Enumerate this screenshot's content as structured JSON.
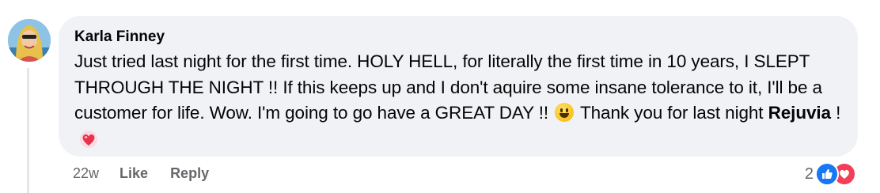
{
  "comment": {
    "author": "Karla Finney",
    "text_part1": "Just tried last night for the first time. HOLY HELL, for literally the first time in 10 years, I SLEPT THROUGH THE NIGHT !! If this keeps up and I don't aquire some insane tolerance to it, I'll be a customer for life. Wow. I'm going to go have a GREAT DAY !!",
    "text_part2": " Thank you for last night ",
    "mention": "Rejuvia",
    "text_part3": " !",
    "emojis": [
      "grinning-face-emoji",
      "heart-emoji"
    ]
  },
  "actions": {
    "timestamp": "22w",
    "like_label": "Like",
    "reply_label": "Reply"
  },
  "reactions": {
    "count": "2",
    "types": [
      "like",
      "love"
    ],
    "colors": {
      "like": "#1877f2",
      "love": "#f33e58"
    }
  }
}
